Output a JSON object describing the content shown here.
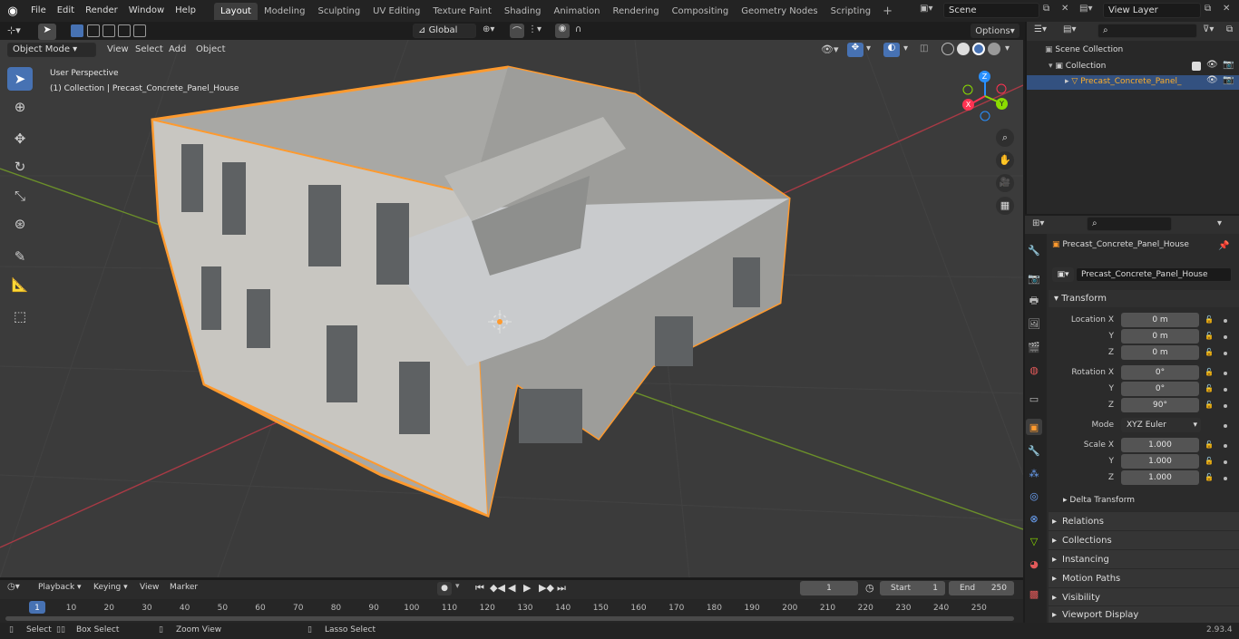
{
  "topbar": {
    "menus": [
      "File",
      "Edit",
      "Render",
      "Window",
      "Help"
    ],
    "workspaces": [
      "Layout",
      "Modeling",
      "Sculpting",
      "UV Editing",
      "Texture Paint",
      "Shading",
      "Animation",
      "Rendering",
      "Compositing",
      "Geometry Nodes",
      "Scripting"
    ],
    "active_workspace": "Layout",
    "scene": "Scene",
    "view_layer": "View Layer"
  },
  "viewport_header": {
    "mode": "Object Mode",
    "menus": [
      "View",
      "Select",
      "Add",
      "Object"
    ],
    "orientation": "Global",
    "options": "Options"
  },
  "viewport": {
    "perspective": "User Perspective",
    "collection_info": "(1) Collection | Precast_Concrete_Panel_House",
    "gizmo": {
      "x": "X",
      "y": "Y",
      "z": "Z"
    }
  },
  "outliner": {
    "items": [
      {
        "label": "Scene Collection"
      },
      {
        "label": "Collection"
      },
      {
        "label": "Precast_Concrete_Panel_"
      }
    ]
  },
  "properties": {
    "object_name": "Precast_Concrete_Panel_House",
    "data_name": "Precast_Concrete_Panel_House",
    "transform_title": "Transform",
    "location": {
      "label": "Location X",
      "x": "0 m",
      "y": "0 m",
      "z": "0 m"
    },
    "rotation": {
      "label": "Rotation X",
      "x": "0°",
      "y": "0°",
      "z": "90°"
    },
    "mode_label": "Mode",
    "mode": "XYZ Euler",
    "scale": {
      "label": "Scale X",
      "x": "1.000",
      "y": "1.000",
      "z": "1.000"
    },
    "axis_y": "Y",
    "axis_z": "Z",
    "delta": "Delta Transform",
    "panels": [
      "Relations",
      "Collections",
      "Instancing",
      "Motion Paths",
      "Visibility",
      "Viewport Display"
    ]
  },
  "timeline": {
    "menus": [
      "Playback",
      "Keying",
      "View",
      "Marker"
    ],
    "current_frame": "1",
    "start_label": "Start",
    "start": "1",
    "end_label": "End",
    "end": "250",
    "ticks": [
      "1",
      "10",
      "20",
      "30",
      "40",
      "50",
      "60",
      "70",
      "80",
      "90",
      "100",
      "110",
      "120",
      "130",
      "140",
      "150",
      "160",
      "170",
      "180",
      "190",
      "200",
      "210",
      "220",
      "230",
      "240",
      "250"
    ]
  },
  "statusbar": {
    "select": "Select",
    "box_select": "Box Select",
    "zoom_view": "Zoom View",
    "lasso_select": "Lasso Select",
    "version": "2.93.4"
  },
  "colors": {
    "accent": "#4772b3",
    "selection": "#ff9a2e",
    "x_axis": "#ff3352",
    "y_axis": "#8bdc00",
    "z_axis": "#2890ff"
  }
}
